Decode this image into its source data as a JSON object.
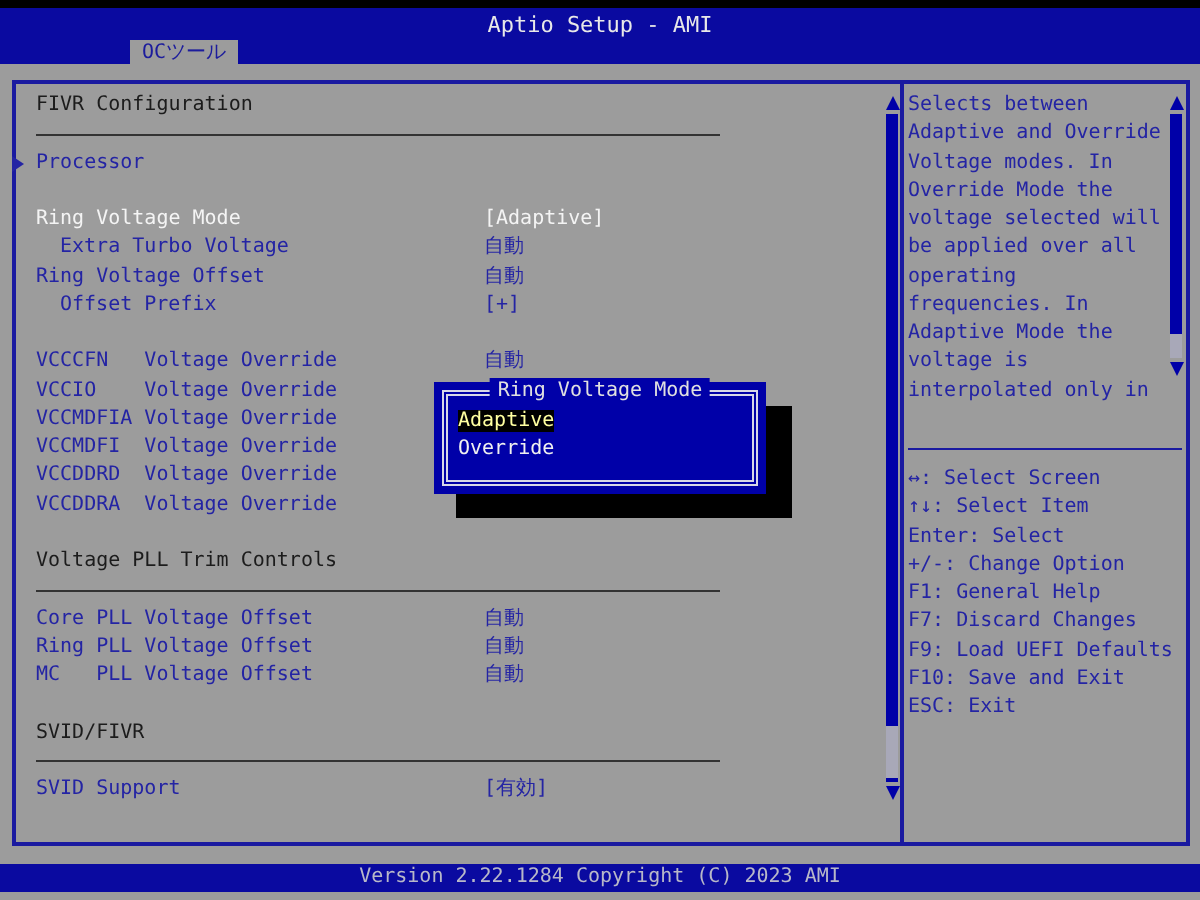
{
  "window": {
    "title": "Aptio Setup - AMI"
  },
  "tabs": [
    {
      "label": "OCツール",
      "selected": true
    }
  ],
  "main": {
    "items": [
      {
        "kind": "heading",
        "label": "FIVR Configuration"
      },
      {
        "kind": "submenu",
        "label": "Processor"
      },
      {
        "kind": "gap"
      },
      {
        "kind": "setting",
        "label": "Ring Voltage Mode",
        "value": "[Adaptive]",
        "selected": true,
        "children": [
          {
            "kind": "setting",
            "label": "Extra Turbo Voltage",
            "value": "自動",
            "selected": false
          }
        ]
      },
      {
        "kind": "setting",
        "label": "Ring Voltage Offset",
        "value": "自動",
        "selected": false,
        "children": [
          {
            "kind": "setting",
            "label": "Offset Prefix",
            "value": "[+]",
            "selected": false
          }
        ]
      },
      {
        "kind": "gap"
      },
      {
        "kind": "setting",
        "label": "VCCCFN   Voltage Override",
        "value": "自動",
        "selected": false
      },
      {
        "kind": "setting",
        "label": "VCCIO    Voltage Override",
        "selected": false
      },
      {
        "kind": "setting",
        "label": "VCCMDFIA Voltage Override",
        "selected": false
      },
      {
        "kind": "setting",
        "label": "VCCMDFI  Voltage Override",
        "selected": false
      },
      {
        "kind": "setting",
        "label": "VCCDDRD  Voltage Override",
        "selected": false
      },
      {
        "kind": "setting",
        "label": "VCCDDRA  Voltage Override",
        "selected": false
      },
      {
        "kind": "gap"
      },
      {
        "kind": "heading",
        "label": "Voltage PLL Trim Controls"
      },
      {
        "kind": "setting",
        "label": "Core PLL Voltage Offset",
        "value": "自動",
        "selected": false
      },
      {
        "kind": "setting",
        "label": "Ring PLL Voltage Offset",
        "value": "自動",
        "selected": false
      },
      {
        "kind": "setting",
        "label": "MC   PLL Voltage Offset",
        "value": "自動",
        "selected": false
      },
      {
        "kind": "gap"
      },
      {
        "kind": "heading",
        "label": "SVID/FIVR"
      },
      {
        "kind": "setting",
        "label": "SVID Support",
        "value": "[有効]",
        "selected": false
      }
    ]
  },
  "popup": {
    "title": "Ring Voltage Mode",
    "options": [
      {
        "label": "Adaptive",
        "selected": true
      },
      {
        "label": "Override",
        "selected": false
      }
    ]
  },
  "help": {
    "text": "Selects between Adaptive and Override Voltage modes. In Override Mode the voltage selected will be applied over all operating frequencies. In Adaptive Mode the voltage is interpolated only in",
    "keys": [
      "↔: Select Screen",
      "↑↓: Select Item",
      "Enter: Select",
      "+/-: Change Option",
      "F1: General Help",
      "F7: Discard Changes",
      "F9: Load UEFI Defaults",
      "F10: Save and Exit",
      "ESC: Exit"
    ]
  },
  "status_bar": {
    "text": "Version 2.22.1284 Copyright (C) 2023 AMI"
  }
}
